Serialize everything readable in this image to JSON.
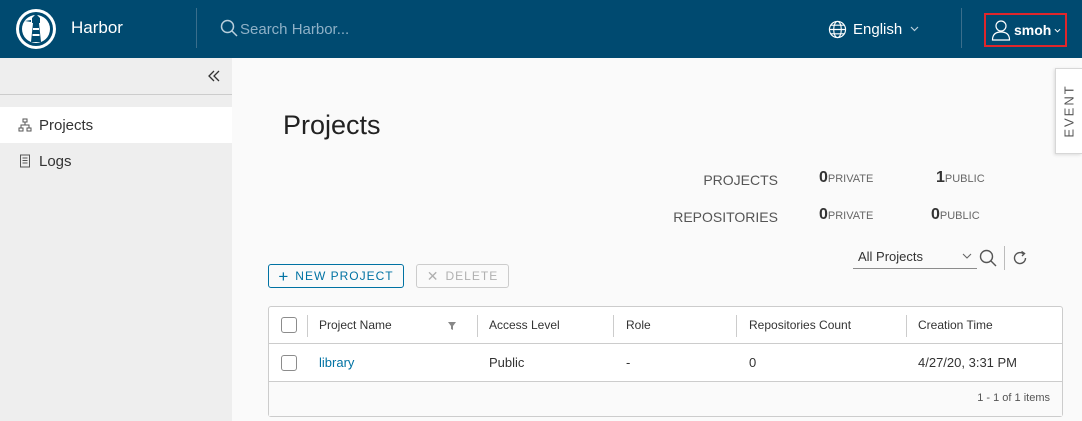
{
  "header": {
    "brand": "Harbor",
    "search_placeholder": "Search Harbor...",
    "language": "English",
    "username": "smoh",
    "bg_color": "#004a70"
  },
  "sidebar": {
    "items": [
      {
        "label": "Projects",
        "icon": "projects-tree-icon"
      },
      {
        "label": "Logs",
        "icon": "logs-document-icon"
      }
    ]
  },
  "event_tab": "EVENT",
  "main": {
    "title": "Projects",
    "stats": {
      "projects_label": "PROJECTS",
      "repositories_label": "REPOSITORIES",
      "projects_private": "0",
      "projects_public": "1",
      "repos_private": "0",
      "repos_public": "0",
      "private_label": "PRIVATE",
      "public_label": "PUBLIC"
    },
    "toolbar": {
      "new_project": "NEW PROJECT",
      "delete": "DELETE",
      "filter_value": "All Projects"
    },
    "table": {
      "columns": [
        "Project Name",
        "Access Level",
        "Role",
        "Repositories Count",
        "Creation Time"
      ],
      "rows": [
        {
          "name": "library",
          "access": "Public",
          "role": "-",
          "repo_count": "0",
          "created": "4/27/20, 3:31 PM"
        }
      ],
      "footer": "1 - 1 of 1 items"
    }
  }
}
